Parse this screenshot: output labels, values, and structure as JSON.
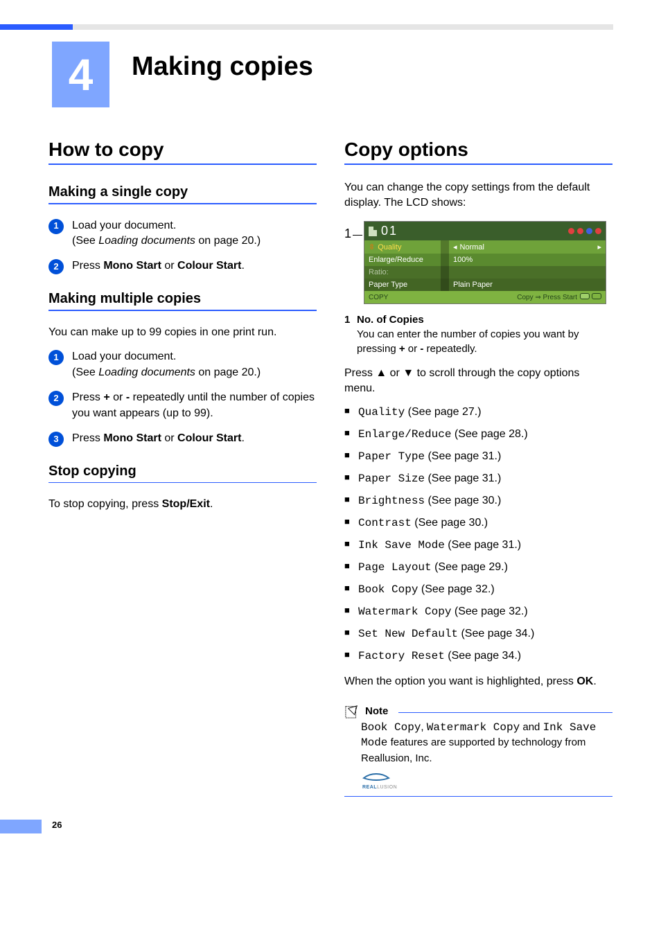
{
  "chapter": {
    "num": "4",
    "title": "Making copies"
  },
  "col_left": {
    "h1": "How to copy",
    "sec_single": {
      "title": "Making a single copy",
      "step1_a": "Load your document.",
      "step1_b1": "(See ",
      "step1_b2": "Loading documents",
      "step1_b3": " on page 20.)",
      "step2_a": "Press ",
      "step2_b": "Mono Start",
      "step2_c": " or ",
      "step2_d": "Colour Start",
      "step2_e": "."
    },
    "sec_multi": {
      "title": "Making multiple copies",
      "intro": "You can make up to 99 copies in one print run.",
      "step1_a": "Load your document.",
      "step1_b1": "(See ",
      "step1_b2": "Loading documents",
      "step1_b3": " on page 20.)",
      "step2_a": "Press ",
      "step2_b": "+",
      "step2_c": " or ",
      "step2_d": "-",
      "step2_e": " repeatedly until the number of copies you want appears (up to 99).",
      "step3_a": "Press ",
      "step3_b": "Mono Start",
      "step3_c": " or ",
      "step3_d": "Colour Start",
      "step3_e": "."
    },
    "sec_stop": {
      "title": "Stop copying",
      "text_a": "To stop copying, press ",
      "text_b": "Stop/Exit",
      "text_c": "."
    }
  },
  "col_right": {
    "h1": "Copy options",
    "intro": "You can change the copy settings from the default display. The LCD shows:",
    "lcd": {
      "callout": "1",
      "count": "01",
      "dots": [
        "#e04040",
        "#e04040",
        "#4060e0",
        "#e04040"
      ],
      "rows": {
        "quality": {
          "label": "Quality",
          "value": "Normal"
        },
        "enlarge": {
          "label": "Enlarge/Reduce",
          "value": "100%"
        },
        "ratio": {
          "label": "Ratio:",
          "value": ""
        },
        "paper": {
          "label": "Paper Type",
          "value": "Plain Paper"
        }
      },
      "bottom_left": "COPY",
      "bottom_right": "Copy ⇒ Press Start"
    },
    "legend": {
      "num": "1",
      "title": "No. of Copies",
      "body_a": "You can enter the number of copies you want by pressing ",
      "body_b": "+",
      "body_c": " or ",
      "body_d": "-",
      "body_e": " repeatedly."
    },
    "scroll_a": "Press ",
    "scroll_b": "▲",
    "scroll_c": " or ",
    "scroll_d": "▼",
    "scroll_e": " to scroll through the copy options menu.",
    "options": [
      {
        "opt": "Quality",
        "page": " (See page 27.)"
      },
      {
        "opt": "Enlarge/Reduce",
        "page": " (See page 28.)"
      },
      {
        "opt": "Paper Type",
        "page": " (See page 31.)"
      },
      {
        "opt": "Paper Size",
        "page": " (See page 31.)"
      },
      {
        "opt": "Brightness",
        "page": " (See page 30.)"
      },
      {
        "opt": "Contrast",
        "page": " (See page 30.)"
      },
      {
        "opt": "Ink Save Mode",
        "page": " (See page 31.)"
      },
      {
        "opt": "Page Layout",
        "page": " (See page 29.)"
      },
      {
        "opt": "Book Copy",
        "page": " (See page 32.)"
      },
      {
        "opt": "Watermark Copy",
        "page": " (See page 32.)"
      },
      {
        "opt": "Set New Default",
        "page": " (See page 34.)"
      },
      {
        "opt": "Factory Reset",
        "page": " (See page 34.)"
      }
    ],
    "closing_a": "When the option you want is highlighted, press ",
    "closing_b": "OK",
    "closing_c": ".",
    "note": {
      "title": "Note",
      "body_a": "Book Copy",
      "body_b": ", ",
      "body_c": "Watermark Copy",
      "body_d": " and ",
      "body_e": "Ink Save Mode",
      "body_f": " features are supported by technology from Reallusion, Inc.",
      "logo_text": "REALLUSION"
    }
  },
  "page_number": "26"
}
